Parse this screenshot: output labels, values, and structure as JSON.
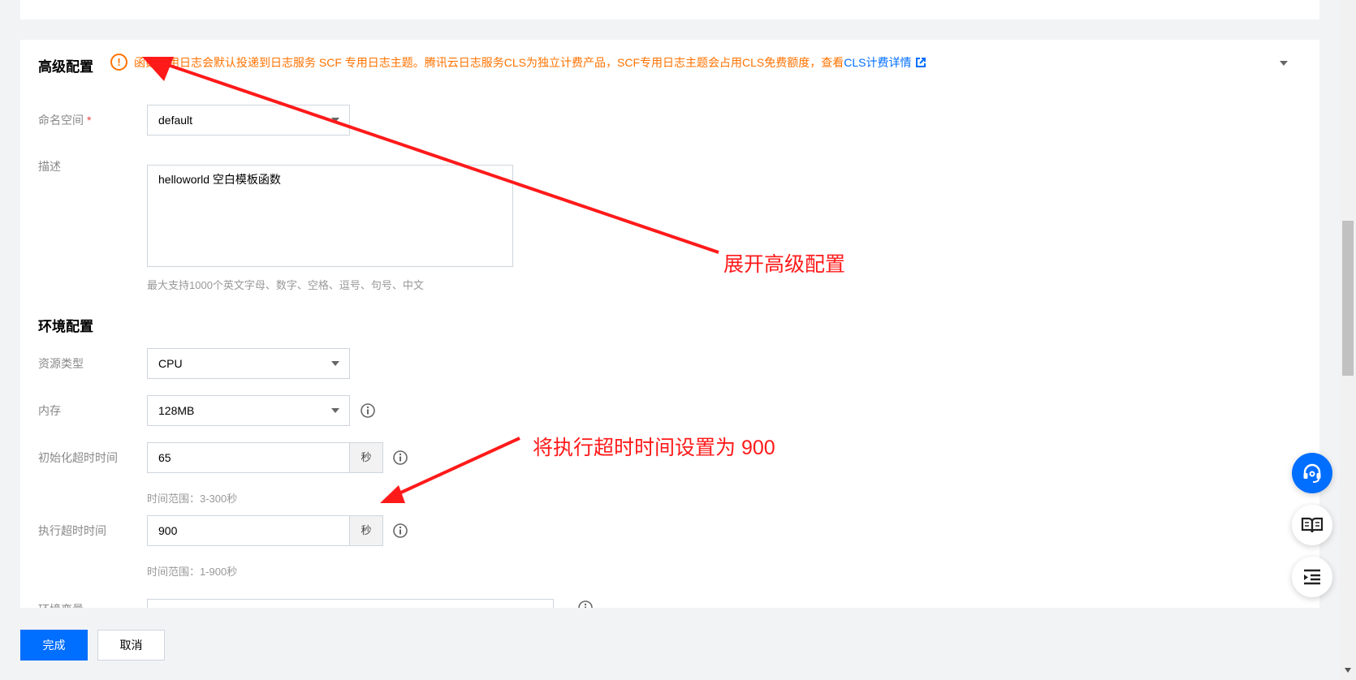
{
  "advanced": {
    "title": "高级配置",
    "notice": "函数启用日志会默认投递到日志服务 SCF 专用日志主题。腾讯云日志服务CLS为独立计费产品，SCF专用日志主题会占用CLS免费额度，查看",
    "notice_link": "CLS计费详情",
    "namespace_label": "命名空间",
    "required_mark": "*",
    "namespace_value": "default",
    "description_label": "描述",
    "description_value": "helloworld 空白模板函数",
    "description_hint": "最大支持1000个英文字母、数字、空格、逗号、句号、中文"
  },
  "environment": {
    "title": "环境配置",
    "resource_type_label": "资源类型",
    "resource_type_value": "CPU",
    "memory_label": "内存",
    "memory_value": "128MB",
    "init_timeout_label": "初始化超时时间",
    "init_timeout_value": "65",
    "init_timeout_unit": "秒",
    "init_timeout_hint": "时间范围：3-300秒",
    "exec_timeout_label": "执行超时时间",
    "exec_timeout_value": "900",
    "exec_timeout_unit": "秒",
    "exec_timeout_hint": "时间范围：1-900秒",
    "env_vars_label": "环境变量"
  },
  "footer": {
    "done_label": "完成",
    "cancel_label": "取消"
  },
  "annotations": {
    "expand_advanced": "展开高级配置",
    "set_timeout": "将执行超时时间设置为 900"
  },
  "colors": {
    "primary": "#006eff",
    "warning": "#ff7200",
    "annotation": "#ff1a1a",
    "required": "#e54545"
  },
  "icons": {
    "notice": "warning-circle-icon",
    "external_link": "external-link-icon",
    "info": "info-icon",
    "support": "headset-icon",
    "docs": "book-icon",
    "outline": "indent-list-icon",
    "collapse": "chevron-down-icon"
  }
}
